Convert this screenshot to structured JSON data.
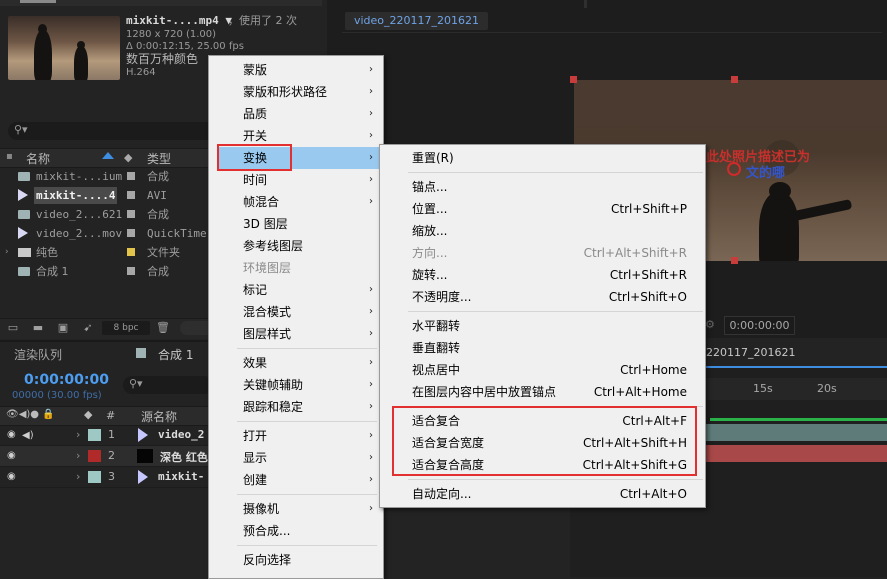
{
  "project": {
    "footage": {
      "name": "mixkit-....mp4 ▼",
      "usage": "，使用了 2 次",
      "resolution": "1280 x 720 (1.00)",
      "duration": "Δ 0:00:12:15, 25.00 fps",
      "colors": "数百万种颜色",
      "codec": "H.264"
    },
    "columns": {
      "name": "名称",
      "type": "类型"
    },
    "items": [
      {
        "name": "mixkit-...ium",
        "type": "合成"
      },
      {
        "name": "mixkit-....4",
        "type": "AVI"
      },
      {
        "name": "video_2...621",
        "type": "合成"
      },
      {
        "name": "video_2...mov",
        "type": "QuickTime"
      },
      {
        "name": "纯色",
        "type": "文件夹"
      },
      {
        "name": "合成 1",
        "type": "合成"
      }
    ],
    "bpc": "8 bpc"
  },
  "timeline": {
    "tabs": [
      "渲染队列",
      "合成 1"
    ],
    "timecode": "0:00:00:00",
    "fps": "00000 (30.00 fps)",
    "col_source": "源名称",
    "col_num": "#",
    "layers": [
      {
        "num": "1",
        "name": "video_2",
        "color": "#9ec8c4"
      },
      {
        "num": "2",
        "name": "深色 红色",
        "color": "#b02a2a"
      },
      {
        "num": "3",
        "name": "mixkit-",
        "color": "#9ec8c4"
      }
    ],
    "comp_tab": "220117_201621",
    "ruler": [
      "15s",
      "20s"
    ]
  },
  "viewer": {
    "comp_tab": "video_220117_201621",
    "timecode": "0:00:00:00",
    "overlay_line1": "此处照片描述已为",
    "overlay_line2": "文的哪"
  },
  "context_menu": [
    {
      "label": "蒙版",
      "submenu": true
    },
    {
      "label": "蒙版和形状路径",
      "submenu": true
    },
    {
      "label": "品质",
      "submenu": true
    },
    {
      "label": "开关",
      "submenu": true
    },
    {
      "label": "变换",
      "submenu": true,
      "selected": true
    },
    {
      "label": "时间",
      "submenu": true
    },
    {
      "label": "帧混合",
      "submenu": true
    },
    {
      "label": "3D 图层",
      "submenu": false
    },
    {
      "label": "参考线图层",
      "submenu": false
    },
    {
      "label": "环境图层",
      "submenu": false,
      "disabled": true
    },
    {
      "label": "标记",
      "submenu": true
    },
    {
      "label": "混合模式",
      "submenu": true
    },
    {
      "label": "图层样式",
      "submenu": true
    },
    {
      "label": "效果",
      "submenu": true
    },
    {
      "label": "关键帧辅助",
      "submenu": true
    },
    {
      "label": "跟踪和稳定",
      "submenu": true
    },
    {
      "label": "打开",
      "submenu": true
    },
    {
      "label": "显示",
      "submenu": true
    },
    {
      "label": "创建",
      "submenu": true
    },
    {
      "label": "摄像机",
      "submenu": true
    },
    {
      "label": "预合成...",
      "submenu": false
    },
    {
      "label": "反向选择",
      "submenu": false
    }
  ],
  "transform_menu": [
    {
      "label": "重置(R)",
      "shortcut": ""
    },
    {
      "label": "锚点...",
      "shortcut": ""
    },
    {
      "label": "位置...",
      "shortcut": "Ctrl+Shift+P"
    },
    {
      "label": "缩放...",
      "shortcut": ""
    },
    {
      "label": "方向...",
      "shortcut": "Ctrl+Alt+Shift+R",
      "disabled": true
    },
    {
      "label": "旋转...",
      "shortcut": "Ctrl+Shift+R"
    },
    {
      "label": "不透明度...",
      "shortcut": "Ctrl+Shift+O"
    },
    {
      "label": "水平翻转",
      "shortcut": ""
    },
    {
      "label": "垂直翻转",
      "shortcut": ""
    },
    {
      "label": "视点居中",
      "shortcut": "Ctrl+Home"
    },
    {
      "label": "在图层内容中居中放置锚点",
      "shortcut": "Ctrl+Alt+Home"
    },
    {
      "label": "适合复合",
      "shortcut": "Ctrl+Alt+F"
    },
    {
      "label": "适合复合宽度",
      "shortcut": "Ctrl+Alt+Shift+H"
    },
    {
      "label": "适合复合高度",
      "shortcut": "Ctrl+Alt+Shift+G"
    },
    {
      "label": "自动定向...",
      "shortcut": "Ctrl+Alt+O"
    }
  ],
  "colors": {
    "highlight": "#99c9ef",
    "annotation": "#e23030",
    "timecode": "#4d9df0"
  }
}
